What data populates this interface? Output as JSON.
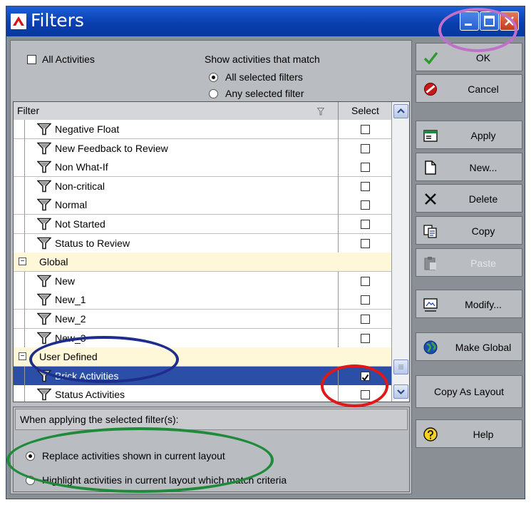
{
  "window": {
    "title": "Filters"
  },
  "top": {
    "all_activities_label": "All Activities",
    "match_heading": "Show activities that match",
    "match_options": [
      "All selected filters",
      "Any selected filter"
    ]
  },
  "grid": {
    "col_filter": "Filter",
    "col_select": "Select",
    "rows": [
      {
        "type": "item",
        "label": "Negative Float",
        "checked": false
      },
      {
        "type": "item",
        "label": "New Feedback to Review",
        "checked": false
      },
      {
        "type": "item",
        "label": "Non What-If",
        "checked": false
      },
      {
        "type": "item",
        "label": "Non-critical",
        "checked": false
      },
      {
        "type": "item",
        "label": "Normal",
        "checked": false
      },
      {
        "type": "item",
        "label": "Not Started",
        "checked": false
      },
      {
        "type": "item",
        "label": "Status to Review",
        "checked": false
      },
      {
        "type": "group",
        "label": "Global",
        "expander": "−"
      },
      {
        "type": "item",
        "label": "New",
        "checked": false
      },
      {
        "type": "item",
        "label": "New_1",
        "checked": false
      },
      {
        "type": "item",
        "label": "New_2",
        "checked": false
      },
      {
        "type": "item",
        "label": "New_3",
        "checked": false
      },
      {
        "type": "group",
        "label": "User Defined",
        "expander": "−"
      },
      {
        "type": "item",
        "label": "Brick Activities",
        "checked": true,
        "selected": true
      },
      {
        "type": "item",
        "label": "Status Activities",
        "checked": false
      }
    ]
  },
  "bottom": {
    "prompt": "When applying the selected filter(s):",
    "options": [
      "Replace activities shown in current layout",
      "Highlight activities in current layout which match criteria"
    ]
  },
  "buttons": [
    {
      "label": "OK",
      "icon": "checkmark-icon"
    },
    {
      "label": "Cancel",
      "icon": "cancel-icon"
    },
    {
      "label": "Apply",
      "icon": "apply-icon"
    },
    {
      "label": "New...",
      "icon": "new-document-icon"
    },
    {
      "label": "Delete",
      "icon": "delete-x-icon"
    },
    {
      "label": "Copy",
      "icon": "copy-icon"
    },
    {
      "label": "Paste",
      "icon": "paste-icon",
      "disabled": true
    },
    {
      "label": "Modify...",
      "icon": "modify-icon"
    },
    {
      "label": "Make Global",
      "icon": "globe-icon"
    },
    {
      "label": "Copy As Layout",
      "icon": ""
    },
    {
      "label": "Help",
      "icon": "help-icon"
    }
  ],
  "colors": {
    "titlebar": "#0a3fb0",
    "selection": "#2b4fa6",
    "group_row": "#fff8d8",
    "annotation_purple": "#c070c8",
    "annotation_navy": "#1e2d8c",
    "annotation_red": "#e01818",
    "annotation_green": "#1f8a3a"
  }
}
